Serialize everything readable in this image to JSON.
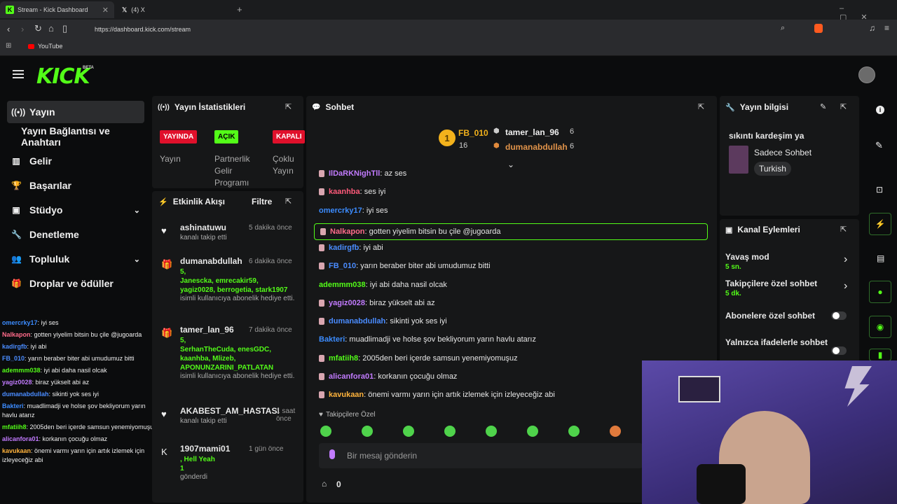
{
  "browser": {
    "tab1_title": "Stream - Kick Dashboard",
    "tab2_title": "(4) X",
    "url": "https://dashboard.kick.com/stream",
    "bookmark": "YouTube"
  },
  "brand": {
    "logo": "KICK",
    "beta": "BETA"
  },
  "sidebar": {
    "items": [
      {
        "label": "Yayın",
        "icon": "broadcast-icon"
      },
      {
        "label": "Yayın Bağlantısı ve Anahtarı",
        "icon": ""
      },
      {
        "label": "Gelir",
        "icon": "chart-icon"
      },
      {
        "label": "Başarılar",
        "icon": "trophy-icon"
      },
      {
        "label": "Stüdyo",
        "icon": "studio-icon"
      },
      {
        "label": "Denetleme",
        "icon": "wrench-icon"
      },
      {
        "label": "Topluluk",
        "icon": "users-icon"
      },
      {
        "label": "Droplar ve ödüller",
        "icon": "gift-icon"
      }
    ]
  },
  "left_chat": [
    {
      "user": "omercrky17",
      "text": ": iyi ses",
      "color": "#3c8cff"
    },
    {
      "user": "Nalkapon",
      "text": ": gotten yiyelim bitsin bu çile @jugoarda",
      "color": "#ff6b8a"
    },
    {
      "user": "kadirgfb",
      "text": ": iyi abi",
      "color": "#4a8cff"
    },
    {
      "user": "FB_010",
      "text": ": yarın beraber biter abi umudumuz bitti",
      "color": "#4a8cff"
    },
    {
      "user": "ademmm038",
      "text": ": iyi abi daha nasil olcak",
      "color": "#53fc18"
    },
    {
      "user": "yagiz0028",
      "text": ": biraz yükselt abi az",
      "color": "#c27bff"
    },
    {
      "user": "dumanabdullah",
      "text": ": sikinti yok ses iyi",
      "color": "#4a8cff"
    },
    {
      "user": "Bakteri",
      "text": ": muadlimadji ve holse şov bekliyorum yarın havlu atarız",
      "color": "#3c8cff"
    },
    {
      "user": "mfatiih8",
      "text": ": 2005den beri içerde samsun yenemiyomuşuz",
      "color": "#53fc18"
    },
    {
      "user": "alicanfora01",
      "text": ": korkanın çocuğu olmaz",
      "color": "#c27bff"
    },
    {
      "user": "kavukaan",
      "text": ": önemi varmı yarın için artık izlemek için izleyeceğiz abi",
      "color": "#ffb33c"
    }
  ],
  "stats": {
    "title": "Yayın İstatistikleri",
    "badges": [
      {
        "label": "YAYINDA",
        "sub": "Yayın",
        "color": "#e0102b"
      },
      {
        "label": "AÇIK",
        "sub": "Partnerlik Gelir Programı",
        "color": "#53fc18"
      },
      {
        "label": "KAPALI",
        "sub": "Çoklu Yayın",
        "color": "#e0102b"
      }
    ]
  },
  "activity": {
    "title": "Etkinlik Akışı",
    "filter": "Filtre",
    "items": [
      {
        "user": "ashinatuwu",
        "time": "5 dakika önce",
        "lines": [],
        "note": "kanalı takip etti",
        "icon": "heart-icon"
      },
      {
        "user": "dumanabdullah",
        "time": "6 dakika önce",
        "lines": [
          "5,",
          "Janescka, emrecakir59,",
          "yagiz0028, berrogetia, stark1907"
        ],
        "note": "isimli kullanıcıya abonelik hediye etti.",
        "icon": "gift-icon"
      },
      {
        "user": "tamer_lan_96",
        "time": "7 dakika önce",
        "lines": [
          "5,",
          "SerhanTheCuda, enesGDC,",
          "kaanhba, Mlizeb,",
          "APONUNZARINI_PATLATAN"
        ],
        "note": "isimli kullanıcıya abonelik hediye etti.",
        "icon": "gift-icon"
      },
      {
        "user": "AKABEST_AM_HASTASI",
        "time": "1 saat önce",
        "lines": [],
        "note": "kanalı takip etti",
        "icon": "heart-icon"
      },
      {
        "user": "1907mami01",
        "time": "1 gün önce",
        "lines": [
          ", Hell Yeah",
          "1"
        ],
        "note": "gönderdi",
        "icon": "kick-icon"
      }
    ]
  },
  "chat": {
    "title": "Sohbet",
    "leaders": [
      {
        "rank": "1",
        "name": "FB_010",
        "count": "16"
      },
      {
        "name": "tamer_lan_96",
        "count": "6"
      },
      {
        "name": "dumanabdullah",
        "count": "6"
      }
    ],
    "messages": [
      {
        "user": "IlDaRKNighTll",
        "text": ": az ses",
        "color": "#c27bff",
        "badge": true
      },
      {
        "user": "kaanhba",
        "text": ": ses iyi",
        "color": "#ff5a7a",
        "badge": true
      },
      {
        "user": "omercrky17",
        "text": ": iyi ses",
        "color": "#3c8cff",
        "badge": false
      },
      {
        "user": "Nalkapon",
        "text": ": gotten yiyelim bitsin bu çile @jugoarda",
        "color": "#ff6b8a",
        "badge": true
      },
      {
        "user": "kadirgfb",
        "text": ": iyi abi",
        "color": "#4a8cff",
        "badge": true
      },
      {
        "user": "FB_010",
        "text": ": yarın beraber biter abi umudumuz bitti",
        "color": "#4a8cff",
        "badge": true
      },
      {
        "user": "ademmm038",
        "text": ": iyi abi daha nasil olcak",
        "color": "#53fc18",
        "badge": false
      },
      {
        "user": "yagiz0028",
        "text": ": biraz yükselt abi az",
        "color": "#c27bff",
        "badge": true
      },
      {
        "user": "dumanabdullah",
        "text": ": sikinti yok ses iyi",
        "color": "#4a8cff",
        "badge": true
      },
      {
        "user": "Bakteri",
        "text": ": muadlimadji ve holse şov bekliyorum yarın havlu atarız",
        "color": "#3c8cff",
        "badge": false
      },
      {
        "user": "mfatiih8",
        "text": ": 2005den beri içerde samsun yenemiyomuşuz",
        "color": "#53fc18",
        "badge": true
      },
      {
        "user": "alicanfora01",
        "text": ": korkanın çocuğu olmaz",
        "color": "#c27bff",
        "badge": true
      },
      {
        "user": "kavukaan",
        "text": ": önemi varmı yarın için artık izlemek için izleyeceğiz abi",
        "color": "#ffb33c",
        "badge": true
      }
    ],
    "followers_only": "Takipçilere Özel",
    "placeholder": "Bir mesaj gönderin",
    "points": "0"
  },
  "info": {
    "title": "Yayın bilgisi",
    "stream_title": "sıkıntı kardeşim ya",
    "category": "Sadece Sohbet",
    "language": "Turkish"
  },
  "actions": {
    "title": "Kanal Eylemleri",
    "items": [
      {
        "label": "Yavaş mod",
        "sub": "5 sn.",
        "type": "arrow"
      },
      {
        "label": "Takipçilere özel sohbet",
        "sub": "5 dk.",
        "type": "arrow"
      },
      {
        "label": "Abonelere özel sohbet",
        "sub": "",
        "type": "toggle"
      },
      {
        "label": "Yalnızca ifadelerle sohbet",
        "sub": "",
        "type": "toggle"
      }
    ]
  }
}
